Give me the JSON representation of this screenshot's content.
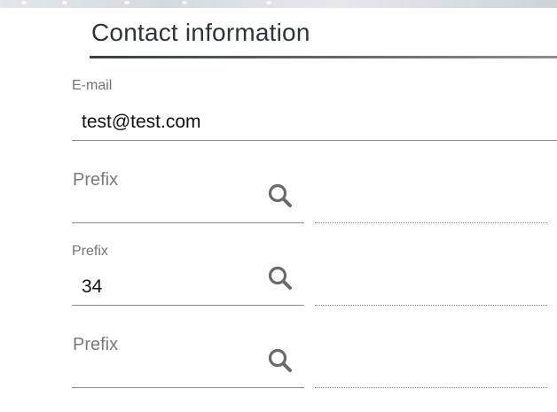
{
  "section": {
    "title": "Contact information"
  },
  "email": {
    "label": "E-mail",
    "value": "test@test.com"
  },
  "phones": [
    {
      "label": "Prefix",
      "value": "",
      "search_icon": "search-icon"
    },
    {
      "label": "Prefix",
      "value": "34",
      "search_icon": "search-icon"
    },
    {
      "label": "Prefix",
      "value": "",
      "search_icon": "search-icon"
    }
  ],
  "colors": {
    "title_text": "#2f3438",
    "label_text": "#737373",
    "value_text": "#111111",
    "underline": "#8a8a8a",
    "icon": "#6a6a6a"
  }
}
